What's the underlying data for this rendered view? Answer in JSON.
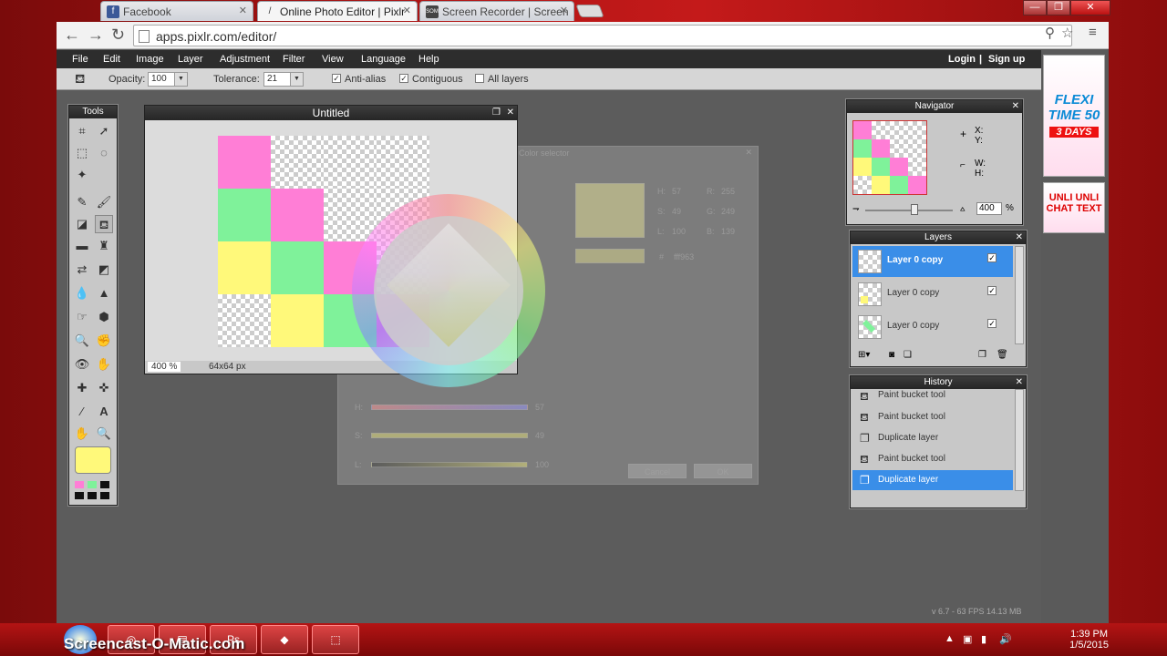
{
  "tabs": [
    {
      "label": "Facebook",
      "icon": "f"
    },
    {
      "label": "Online Photo Editor | Pixlr",
      "icon": "/"
    },
    {
      "label": "Screen Recorder | Screen",
      "icon": "SOM"
    }
  ],
  "url": "apps.pixlr.com/editor/",
  "menu": [
    "File",
    "Edit",
    "Image",
    "Layer",
    "Adjustment",
    "Filter",
    "View",
    "Language",
    "Help"
  ],
  "auth": {
    "login": "Login",
    "sep": "|",
    "signup": "Sign up"
  },
  "options": {
    "opacity_label": "Opacity:",
    "opacity_value": "100",
    "tolerance_label": "Tolerance:",
    "tolerance_value": "21",
    "antialias": "Anti-alias",
    "contiguous": "Contiguous",
    "all_layers": "All layers"
  },
  "tools_title": "Tools",
  "canvas": {
    "title": "Untitled",
    "zoom": "400",
    "zoom_unit": "%",
    "size": "64x64 px"
  },
  "color_selector": {
    "title": "Color selector",
    "hex": "fff963",
    "H": "57",
    "S": "49",
    "L": "100",
    "R": "255",
    "G": "249",
    "B": "139",
    "ok": "OK",
    "cancel": "Cancel",
    "hsl": [
      "H:",
      "S:",
      "L:"
    ],
    "rgb": [
      "R:",
      "G:",
      "B:"
    ],
    "hash": "#"
  },
  "navigator": {
    "title": "Navigator",
    "x": "X:",
    "y": "Y:",
    "w": "W:",
    "h": "H:",
    "zoom": "400",
    "pct": "%"
  },
  "layers": {
    "title": "Layers",
    "items": [
      "Layer 0 copy",
      "Layer 0 copy",
      "Layer 0 copy"
    ]
  },
  "history": {
    "title": "History",
    "items": [
      "Paint bucket tool",
      "Paint bucket tool",
      "Duplicate layer",
      "Paint bucket tool",
      "Duplicate layer"
    ]
  },
  "version": "v 6.7 - 63 FPS 14.13 MB",
  "ads": {
    "ad1": [
      "FLEXI",
      "TIME 50",
      "3 DAYS"
    ],
    "ad2": [
      "UNLI",
      "CHAT",
      "UNLI",
      "TEXT"
    ]
  },
  "taskbar": {
    "time": "1:39 PM",
    "date": "1/5/2015",
    "watermark": "Screencast-O-Matic.com"
  },
  "colors": {
    "pink": "#ff7ed6",
    "green": "#7ff29a",
    "yellow": "#fff97a",
    "selected": "#3a8ee8"
  }
}
